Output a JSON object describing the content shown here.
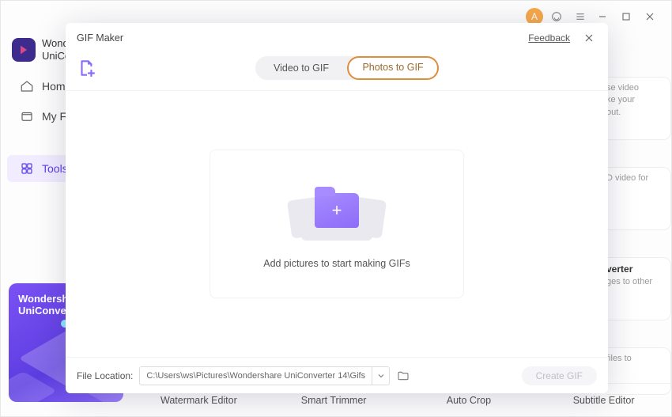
{
  "brand": {
    "line1": "Wondershare",
    "line2": "UniConverter"
  },
  "titlebar": {
    "avatar_initial": "A"
  },
  "sidebar": {
    "items": [
      {
        "label": "Home"
      },
      {
        "label": "My Files"
      },
      {
        "label": "Tools"
      }
    ],
    "promo": {
      "line1": "Wondershare",
      "line2": "UniConverter"
    }
  },
  "right_cards": [
    {
      "snippet1": "se video",
      "snippet2": "ke your",
      "snippet3": "out."
    },
    {
      "snippet1": "D video for"
    },
    {
      "heading": "verter",
      "snippet1": "ges to other"
    },
    {
      "snippet1": "files to"
    }
  ],
  "tool_row": [
    {
      "label": "Watermark Editor"
    },
    {
      "label": "Smart Trimmer"
    },
    {
      "label": "Auto Crop"
    },
    {
      "label": "Subtitle Editor"
    }
  ],
  "modal": {
    "title": "GIF Maker",
    "feedback_label": "Feedback",
    "tabs": {
      "video": "Video to GIF",
      "photos": "Photos to GIF"
    },
    "dropzone_label": "Add pictures to start making GIFs",
    "file_location_label": "File Location:",
    "file_location_path": "C:\\Users\\ws\\Pictures\\Wondershare UniConverter 14\\Gifs",
    "create_button": "Create GIF"
  }
}
